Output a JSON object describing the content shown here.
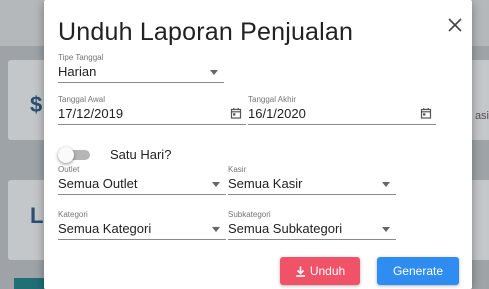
{
  "background": {
    "side_text": "asi"
  },
  "dialog": {
    "title": "Unduh Laporan Penjualan",
    "tipe_tanggal": {
      "label": "Tipe Tanggal",
      "value": "Harian"
    },
    "tanggal_awal": {
      "label": "Tanggal Awal",
      "value": "17/12/2019"
    },
    "tanggal_akhir": {
      "label": "Tanggal Akhir",
      "value": "16/1/2020"
    },
    "satu_hari": {
      "label": "Satu Hari?",
      "checked": false
    },
    "outlet": {
      "label": "Outlet",
      "value": "Semua Outlet"
    },
    "kasir": {
      "label": "Kasir",
      "value": "Semua Kasir"
    },
    "kategori": {
      "label": "Kategori",
      "value": "Semua Kategori"
    },
    "subkategori": {
      "label": "Subkategori",
      "value": "Semua Subkategori"
    },
    "buttons": {
      "unduh": "Unduh",
      "generate": "Generate"
    }
  },
  "colors": {
    "unduh_button": "#f05268",
    "generate_button": "#2f8cf0"
  },
  "icons": {
    "close": "close-icon",
    "calendar": "calendar-icon",
    "download": "download-icon",
    "dropdown": "chevron-down-icon"
  }
}
